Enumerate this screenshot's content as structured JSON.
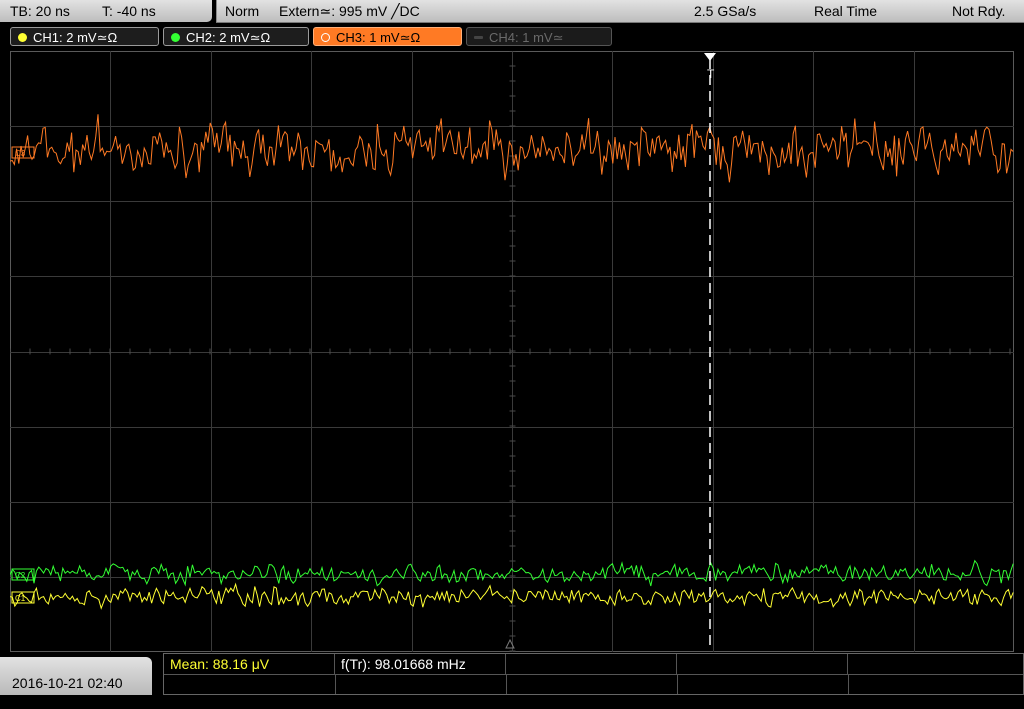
{
  "timebase": {
    "tb": "TB: 20 ns",
    "tpos": "T: -40 ns"
  },
  "status": {
    "mode": "Norm",
    "trigger": "Extern≃: 995 mV ╱DC",
    "sample_rate": "2.5 GSa/s",
    "acq": "Real Time",
    "ready": "Not Rdy."
  },
  "channels": [
    {
      "label": "CH1: 2 mV≃Ω",
      "color": "#ffff33"
    },
    {
      "label": "CH2: 2 mV≃Ω",
      "color": "#33ff33"
    },
    {
      "label": "CH3: 1 mV≃Ω",
      "color": "#ff7a24"
    },
    {
      "label": "CH4: 1 mV≃",
      "color": "#555555"
    }
  ],
  "markers": {
    "c3": "C3",
    "c2": "C2",
    "c1": "C1",
    "trigger": "T"
  },
  "measurements": {
    "mean": "Mean: 88.16 μV",
    "freq": "f(Tr): 98.01668 mHz"
  },
  "datetime": "2016-10-21 02:40",
  "colors": {
    "ch1": "#ffff33",
    "ch2": "#33ff33",
    "ch3": "#ff7a24",
    "mean": "#ffff33",
    "grid": "#3a3a3a"
  }
}
